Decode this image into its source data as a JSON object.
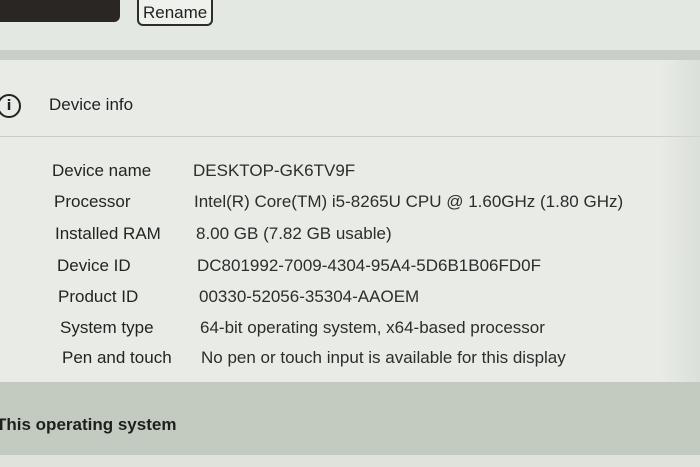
{
  "header": {
    "rename_label": "Rename"
  },
  "device_info": {
    "title": "Device info",
    "icon": "info-icon",
    "specs": [
      {
        "label": "Device name",
        "value": "DESKTOP-GK6TV9F"
      },
      {
        "label": "Processor",
        "value": "Intel(R) Core(TM) i5-8265U CPU @ 1.60GHz (1.80 GHz)"
      },
      {
        "label": "Installed RAM",
        "value": "8.00 GB (7.82 GB usable)"
      },
      {
        "label": "Device ID",
        "value": "DC801992-7009-4304-95A4-5D6B1B06FD0F"
      },
      {
        "label": "Product ID",
        "value": "00330-52056-35304-AAOEM"
      },
      {
        "label": "System type",
        "value": "64-bit operating system, x64-based processor"
      },
      {
        "label": "Pen and touch",
        "value": "No pen or touch input is available for this display"
      }
    ]
  },
  "next_section": {
    "title": "This operating system"
  }
}
